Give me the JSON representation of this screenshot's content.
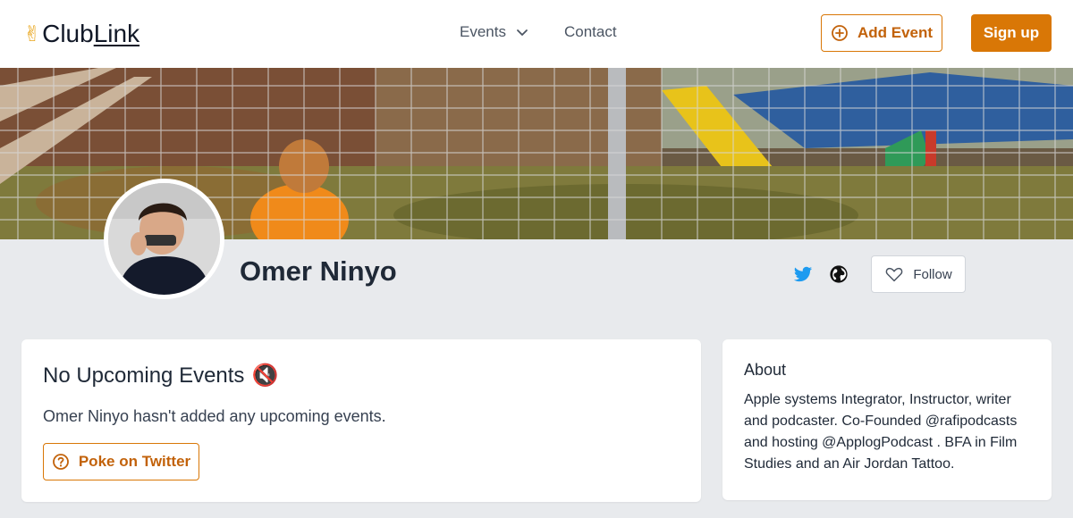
{
  "header": {
    "logo_prefix": "Club",
    "logo_suffix": "Link",
    "nav_events": "Events",
    "nav_contact": "Contact",
    "add_event_label": "Add Event",
    "signup_label": "Sign up"
  },
  "profile": {
    "name": "Omer Ninyo",
    "follow_label": "Follow",
    "twitter_color": "#1d9bf0"
  },
  "events": {
    "title": "No Upcoming Events",
    "title_emoji": "🔇",
    "description": "Omer Ninyo hasn't added any upcoming events.",
    "poke_label": "Poke on Twitter"
  },
  "about": {
    "title": "About",
    "text": "Apple systems Integrator, Instructor, writer and podcaster. Co-Founded @rafipodcasts and hosting @ApplogPodcast . BFA in Film Studies and an Air Jordan Tattoo."
  },
  "colors": {
    "accent": "#d97706",
    "background": "#e8eaed"
  }
}
